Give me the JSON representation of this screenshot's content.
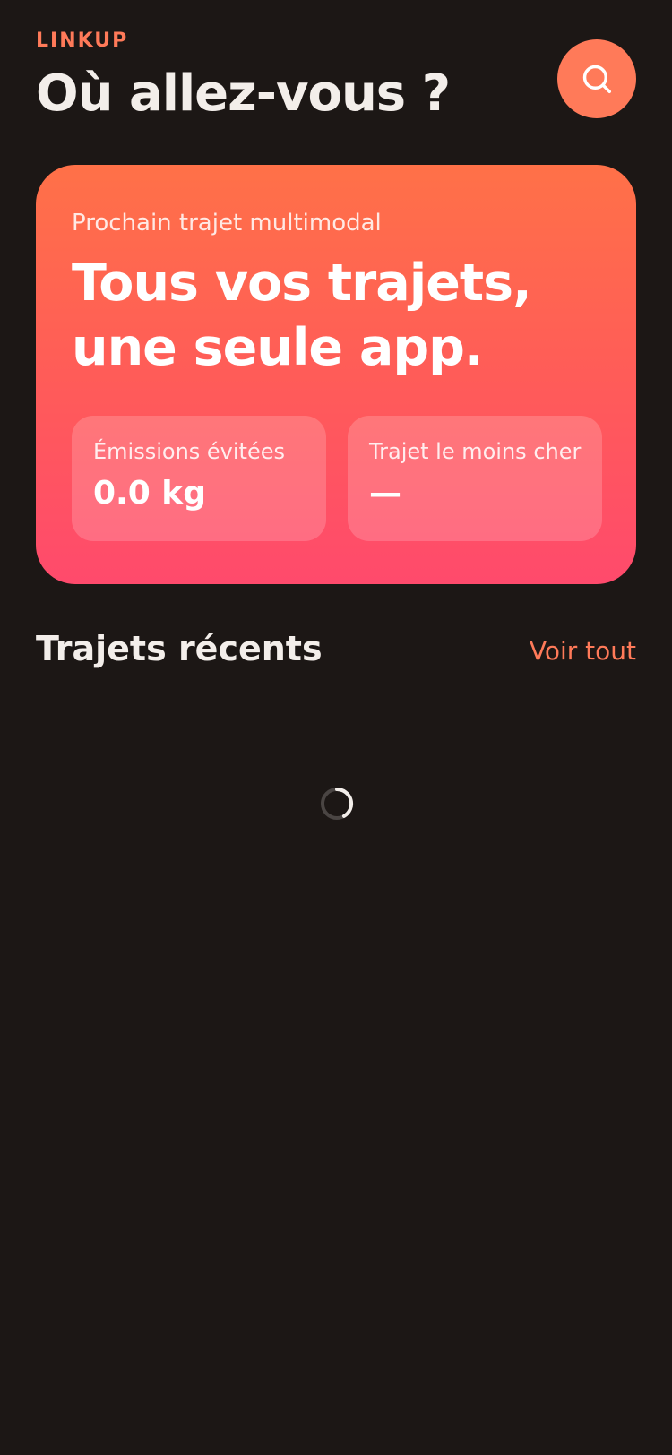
{
  "header": {
    "brand": "LINKUP",
    "title": "Où allez-vous ?",
    "search_icon": "search-icon"
  },
  "hero": {
    "subtitle": "Prochain trajet multimodal",
    "title_line1": "Tous vos trajets,",
    "title_line2": "une seule app.",
    "stats": [
      {
        "label": "Émissions évitées",
        "value": "0.0 kg"
      },
      {
        "label": "Trajet le moins cher",
        "value": "—"
      }
    ]
  },
  "recent": {
    "title": "Trajets récents",
    "see_all": "Voir tout",
    "loading_icon": "spinner-icon"
  },
  "colors": {
    "background": "#1c1715",
    "accent": "#ff7a59",
    "hero_top": "#ff7148",
    "hero_bottom": "#ff4a6c",
    "text_primary": "#f3eeea"
  }
}
